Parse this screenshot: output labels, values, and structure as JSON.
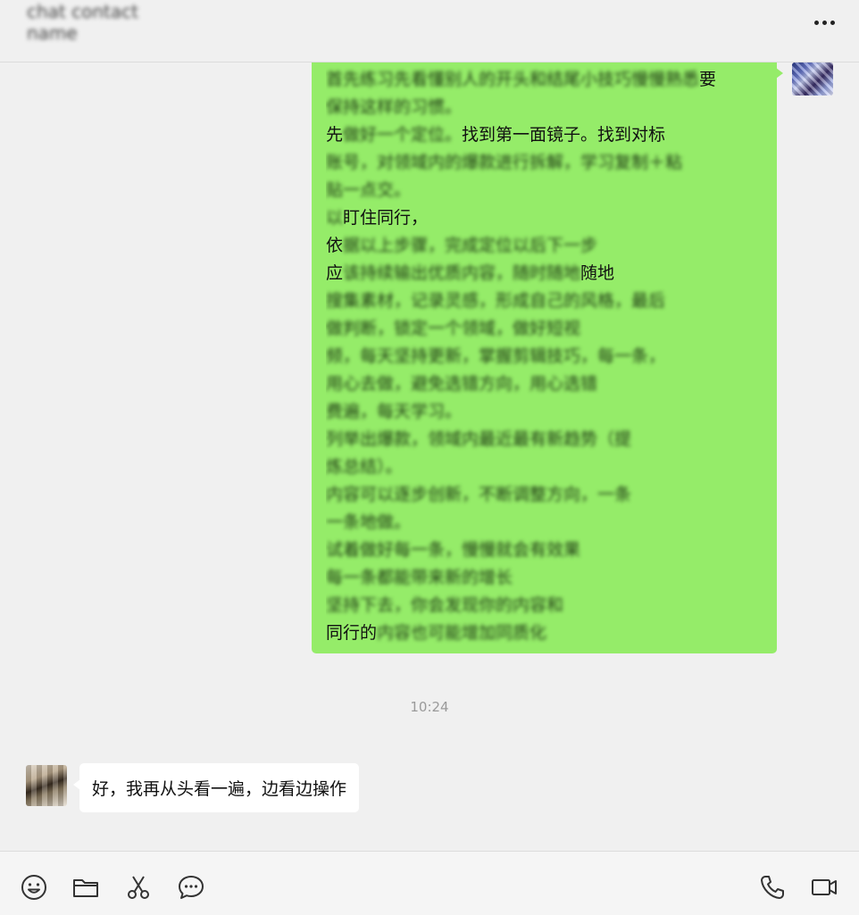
{
  "header": {
    "title": "chat contact name",
    "more_icon": "more-dots-icon"
  },
  "messages": [
    {
      "side": "self",
      "lines": [
        {
          "visible": "",
          "blurred": "首先练习先看懂别人的开头和结尾小技巧慢慢熟悉",
          "tail": "要"
        },
        {
          "visible": "",
          "blurred": "保持这样的习惯。",
          "tail": ""
        },
        {
          "visible": "先",
          "blurred": "做好一个定位。",
          "tail": "找到第一面镜子。找到对标"
        },
        {
          "visible": "",
          "blurred": "账号，对领域内的爆款进行拆解，学习复制＋粘",
          "tail": ""
        },
        {
          "visible": "",
          "blurred": "贴一点交。",
          "tail": ""
        },
        {
          "visible": "",
          "blurred": "以",
          "tail": "盯住同行，"
        },
        {
          "visible": "依",
          "blurred": "据以上步骤，完成定位以后下一步",
          "tail": ""
        },
        {
          "visible": "应",
          "blurred": "该持续输出优质内容，随时随地",
          "tail": "随地"
        },
        {
          "visible": "",
          "blurred": "搜集素材，记录灵感，形成自己的风格，最后",
          "tail": ""
        },
        {
          "visible": "",
          "blurred": "做判断，锁定一个领域，做好短视",
          "tail": ""
        },
        {
          "visible": "",
          "blurred": "频，每天坚持更新，掌握剪辑技巧，每一条，",
          "tail": ""
        },
        {
          "visible": "",
          "blurred": "用心去做，避免选错方向，用心选错",
          "tail": ""
        },
        {
          "visible": "",
          "blurred": "费遍，每天学习。",
          "tail": ""
        },
        {
          "visible": "",
          "blurred": "列举出爆款，领域内最近最有新趋势（提",
          "tail": ""
        },
        {
          "visible": "",
          "blurred": "炼总结）。",
          "tail": ""
        },
        {
          "visible": "",
          "blurred": "内容可以逐步创新，不断调整方向，一条",
          "tail": ""
        },
        {
          "visible": "",
          "blurred": "一条地做。",
          "tail": ""
        },
        {
          "visible": "",
          "blurred": "试着做好每一条，慢慢就会有效果",
          "tail": ""
        },
        {
          "visible": "",
          "blurred": "每一条都能带来新的增长",
          "tail": ""
        },
        {
          "visible": "",
          "blurred": "坚持下去，你会发现你的内容和",
          "tail": ""
        },
        {
          "visible": "同行的",
          "blurred": "内容也可能增加同质化",
          "tail": ""
        }
      ]
    }
  ],
  "timestamp": "10:24",
  "reply": {
    "side": "other",
    "text": "好，我再从头看一遍，边看边操作"
  },
  "toolbar": {
    "left": [
      {
        "name": "emoji-icon"
      },
      {
        "name": "folder-icon"
      },
      {
        "name": "scissors-icon"
      },
      {
        "name": "chat-bubble-icon"
      }
    ],
    "right": [
      {
        "name": "phone-icon"
      },
      {
        "name": "video-camera-icon"
      }
    ]
  },
  "colors": {
    "self_bubble": "#95ec69",
    "other_bubble": "#ffffff",
    "background": "#f0f0f0"
  }
}
